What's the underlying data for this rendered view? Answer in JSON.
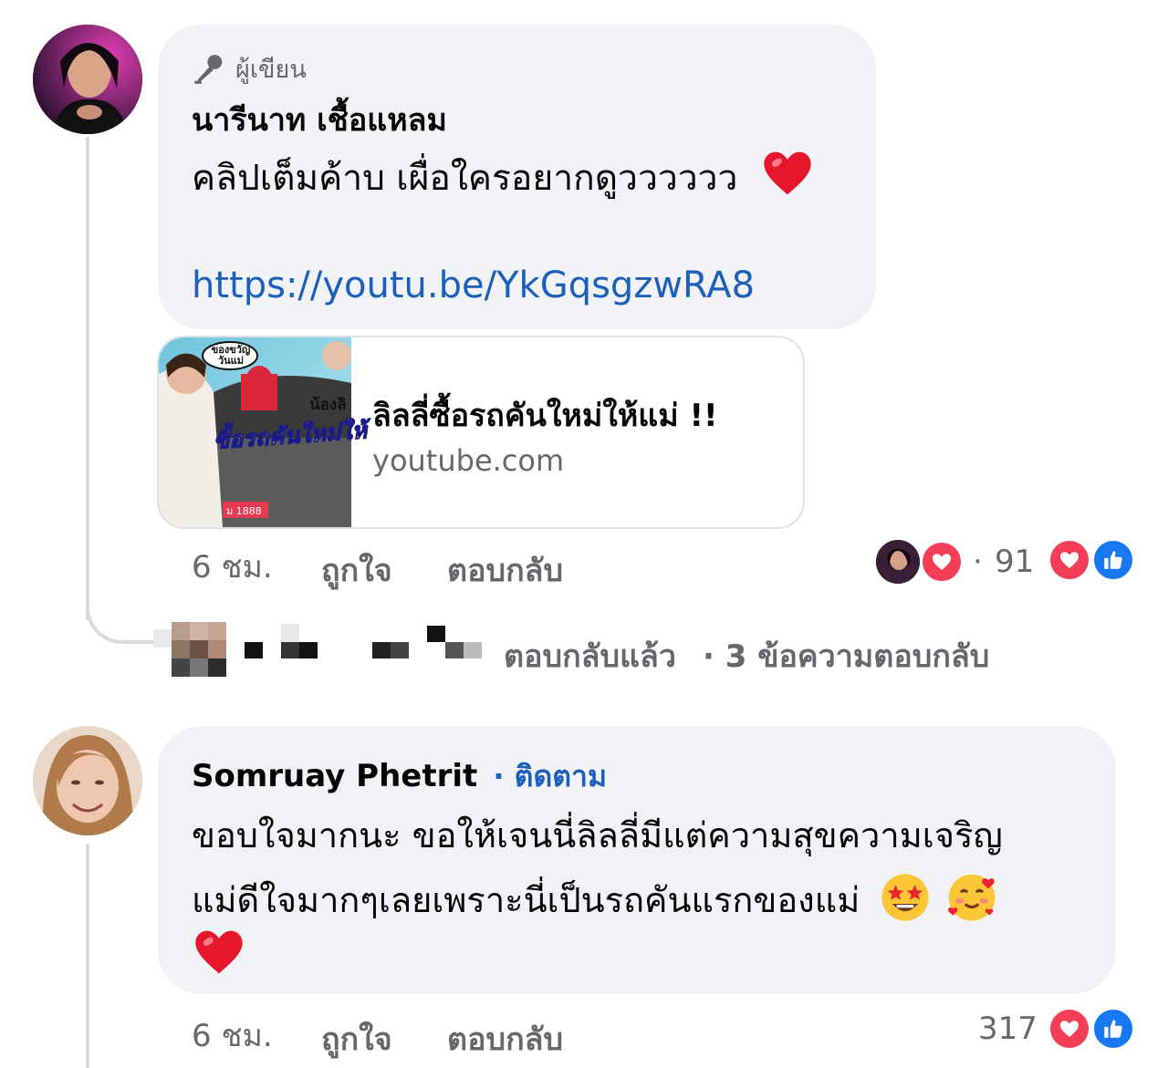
{
  "comment1": {
    "badge": "ผู้เขียน",
    "author": "นารีนาท เชื้อแหลม",
    "text": "คลิปเต็มค้าบ เผื่อใครอยากดูวววววว",
    "text_emoji": "heart",
    "link": "https://youtu.be/YkGqsgzwRA8",
    "preview": {
      "title": "ลิลลี่ซื้อรถคันใหม่ให้แม่ !!",
      "domain": "youtube.com",
      "thumb_caption_top": "ของขวัญวันแม่",
      "thumb_caption_mid": "น้องลิ",
      "thumb_caption_main": "ซื้อรถคันใหม่ให้",
      "thumb_plate": "ม 1888"
    },
    "time": "6 ชม.",
    "like_label": "ถูกใจ",
    "reply_label": "ตอบกลับ",
    "reaction_count": "91",
    "reactions": [
      "love-icon",
      "like-icon"
    ]
  },
  "replies_row": {
    "text": "ตอบกลับแล้ว",
    "count_text": "· 3 ข้อความตอบกลับ"
  },
  "comment2": {
    "author": "Somruay Phetrit",
    "follow": "· ติดตาม",
    "line1": "ขอบใจมากนะ ขอให้เจนนี่ลิลลี่มีแต่ความสุขความเจริญ",
    "line2": "แม่ดีใจมากๆเลยเพราะนี่เป็นรถคันแรกของแม่",
    "emojis": [
      "star-struck-icon",
      "smiling-hearts-icon",
      "heart-icon"
    ],
    "time": "6 ชม.",
    "like_label": "ถูกใจ",
    "reply_label": "ตอบกลับ",
    "reaction_count": "317",
    "reactions": [
      "love-icon",
      "like-icon"
    ]
  },
  "colors": {
    "bubble": "#f0f2f5",
    "link": "#1b5fb8",
    "meta": "#65676b",
    "love": "#f33e58",
    "like": "#1877f2",
    "follow": "#1b5fb8"
  }
}
